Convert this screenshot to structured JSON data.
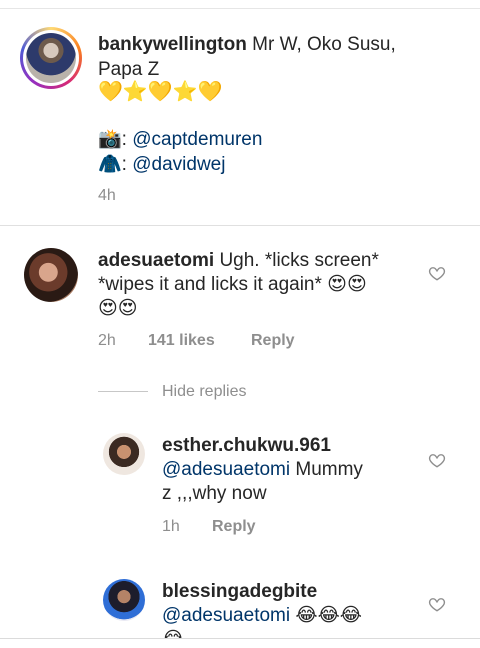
{
  "caption": {
    "username": "bankywellington",
    "text1": "Mr W, Oko Susu,",
    "text2": "Papa Z",
    "hearts_stars": "💛⭐💛⭐💛",
    "credit1_icon": "📸",
    "credit1_mention": "@captdemuren",
    "credit2_icon": "🧥",
    "credit2_mention": "@davidwej",
    "time": "4h"
  },
  "comments": [
    {
      "username": "adesuaetomi",
      "line1": "Ugh. *licks screen*",
      "line2": "*wipes it and licks it again* 😍😍",
      "line3": "😍😍",
      "time": "2h",
      "likes": "141 likes",
      "reply": "Reply"
    }
  ],
  "replies_toggle": {
    "label": "Hide replies"
  },
  "replies": [
    {
      "username": "esther.chukwu.961",
      "mention": "@adesuaetomi",
      "line1": "Mummy",
      "line2": "z ,,,why now",
      "time": "1h",
      "reply": "Reply"
    },
    {
      "username": "blessingadegbite",
      "mention": "@adesuaetomi",
      "emojis": "😂😂😂",
      "overflow_emoji": "😂"
    }
  ],
  "icons": {
    "heart": "heart-outline-icon"
  },
  "colors": {
    "mention": "#003569",
    "meta": "#8e8e8e",
    "text": "#262626"
  }
}
